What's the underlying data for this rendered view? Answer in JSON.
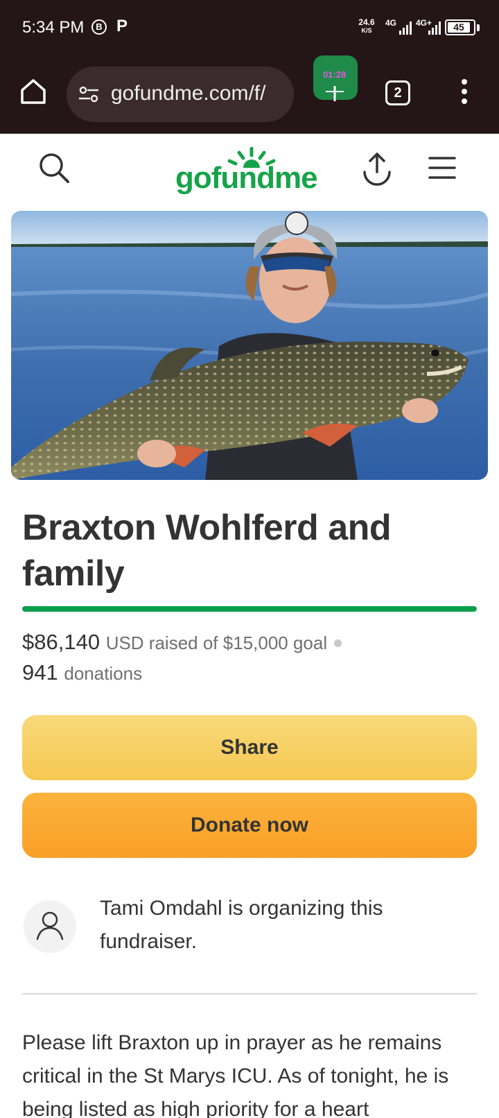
{
  "status_bar": {
    "time": "5:34 PM",
    "b_badge": "B",
    "p_badge": "P",
    "speed_value": "24.6",
    "speed_unit": "K/S",
    "network_1": "4G",
    "network_2": "4G+",
    "battery": "45"
  },
  "browser": {
    "url": "gofundme.com/f/",
    "extension_badge": "01:28",
    "tab_count": "2"
  },
  "site": {
    "logo_text": "gofundme"
  },
  "campaign": {
    "title": "Braxton Wohlferd and family",
    "raised_amount": "$86,140",
    "raised_label": "USD raised of $15,000 goal",
    "donation_count": "941",
    "donations_label": "donations",
    "progress_fraction": 1.0,
    "share_label": "Share",
    "donate_label": "Donate now",
    "organizer_text": "Tami Omdahl is organizing this fundraiser.",
    "story_text": "Please lift Braxton up in prayer as he remains critical in the St Marys ICU. As of tonight, he is being listed as high priority for a heart"
  },
  "colors": {
    "brand_green": "#17a34a",
    "progress_green": "#0b9e4b",
    "share_yellow": "#f5c851",
    "donate_orange": "#f99f28",
    "chrome_bg": "#241617"
  },
  "icons": {
    "home": "home-icon",
    "tune": "tune-icon",
    "search": "search-icon",
    "upload": "share-upload-icon",
    "menu": "hamburger-icon",
    "organizer": "user-icon"
  }
}
